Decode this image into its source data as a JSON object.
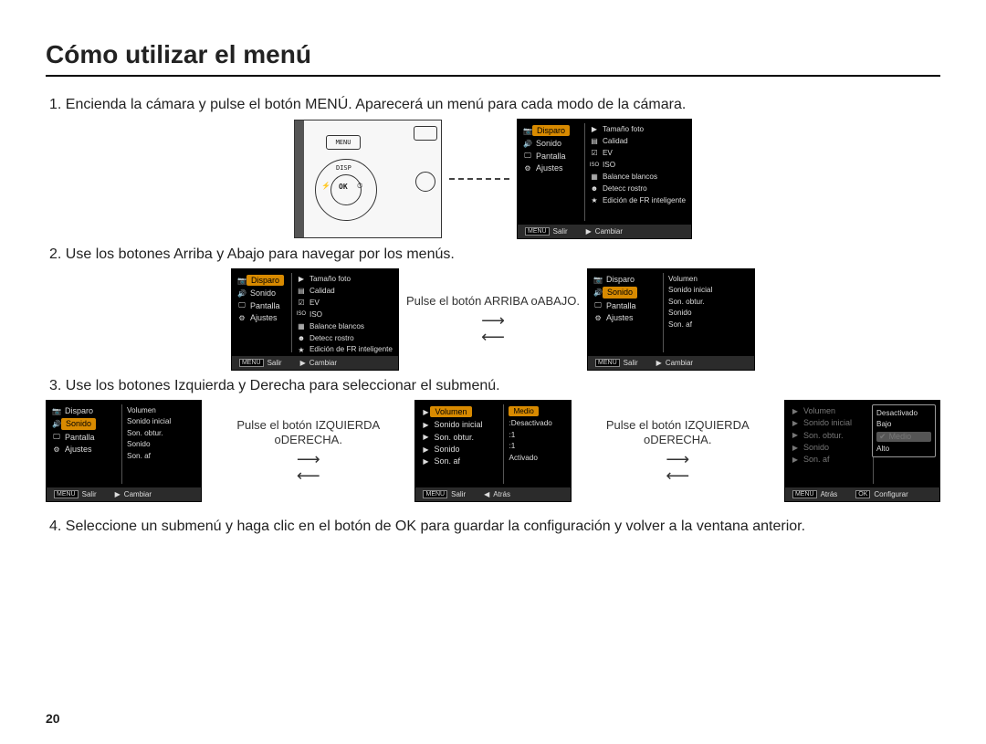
{
  "page_number": "20",
  "title": "Cómo utilizar el menú",
  "steps": {
    "s1": "1. Encienda la cámara y pulse el botón MENÚ. Aparecerá un menú para cada modo de la cámara.",
    "s2": "2. Use los botones Arriba y Abajo para navegar por los menús.",
    "s3": "3. Use los botones Izquierda y Derecha para seleccionar el submenú.",
    "s4": "4. Seleccione un submenú y haga clic en el botón de OK para guardar la configuración y volver a la ventana anterior."
  },
  "camera_labels": {
    "menu": "MENU",
    "disp": "DISP",
    "ok": "OK"
  },
  "arrows": {
    "updown": "Pulse el botón ARRIBA oABAJO.",
    "leftright": "Pulse el botón IZQUIERDA oDERECHA."
  },
  "footer": {
    "menu_key": "MENU",
    "ok_key": "OK",
    "salir": "Salir",
    "cambiar": "Cambiar",
    "atras": "Atrás",
    "config": "Configurar"
  },
  "menu_left": {
    "disparo": "Disparo",
    "sonido": "Sonido",
    "pantalla": "Pantalla",
    "ajustes": "Ajustes"
  },
  "menu_disparo_right": {
    "tamano": "Tamaño foto",
    "calidad": "Calidad",
    "ev": "EV",
    "iso": "ISO",
    "balance": "Balance blancos",
    "detecc": "Detecc rostro",
    "edicion": "Edición de FR inteligente"
  },
  "menu_sonido_right": {
    "volumen": "Volumen",
    "sonido_inicial": "Sonido inicial",
    "son_obtur": "Son. obtur.",
    "sonido": "Sonido",
    "son_af": "Son. af"
  },
  "values": {
    "medio": "Medio",
    "desactivado": ":Desactivado",
    "uno": ":1",
    "activado": "Activado",
    "bajo": "Bajo",
    "alto": "Alto"
  },
  "icons": {
    "camera": "📷",
    "speaker": "🔊",
    "display": "🖵",
    "gear": "⚙",
    "tri": "▶",
    "tri_l": "◀",
    "size": "▣",
    "qual": "▤",
    "ev": "☑",
    "iso": "ISO",
    "wb": "▦",
    "face": "☻",
    "star": "★",
    "check": "✔"
  }
}
